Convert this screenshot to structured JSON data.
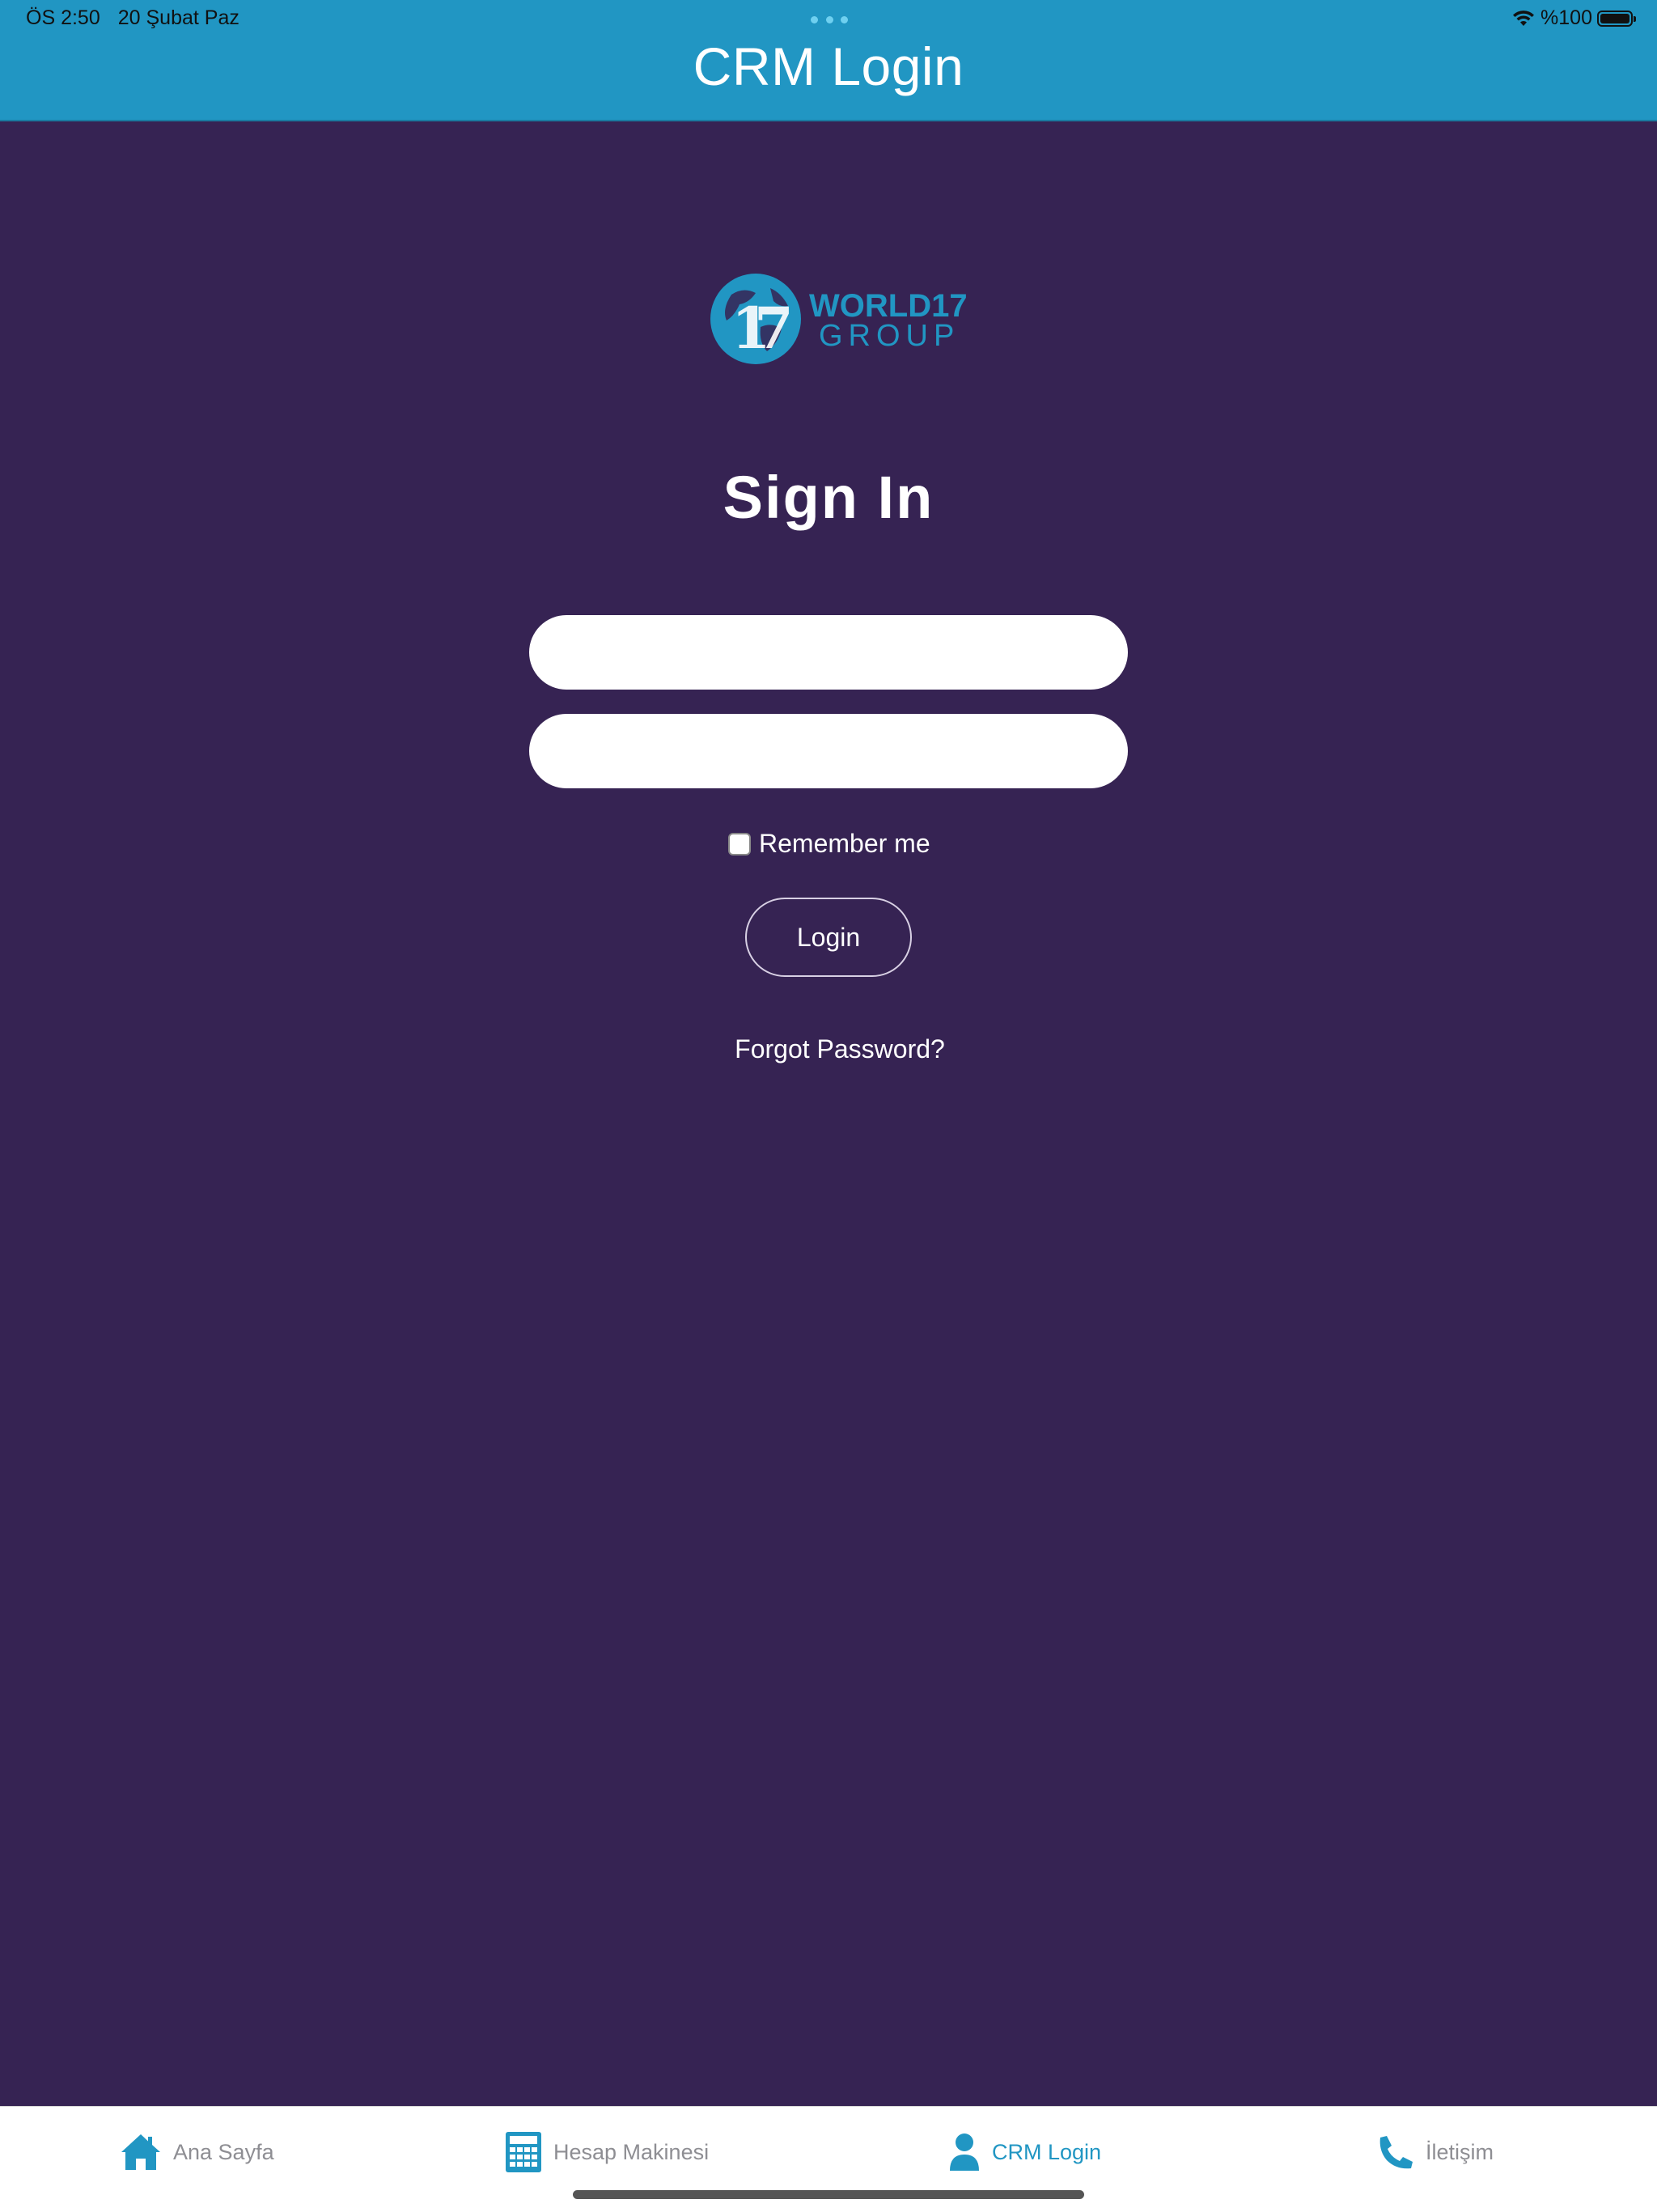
{
  "status_bar": {
    "time": "ÖS 2:50",
    "date": "20 Şubat Paz",
    "battery": "%100"
  },
  "header": {
    "title": "CRM Login"
  },
  "logo": {
    "line1": "WORLD17",
    "line2": "GROUP"
  },
  "form": {
    "title": "Sign In",
    "username_value": "",
    "password_value": "",
    "remember_label": "Remember me",
    "remember_checked": false,
    "login_label": "Login",
    "forgot_label": "Forgot Password?"
  },
  "tabbar": {
    "items": [
      {
        "label": "Ana Sayfa",
        "icon": "home-icon",
        "active": false
      },
      {
        "label": "Hesap Makinesi",
        "icon": "calculator-icon",
        "active": false
      },
      {
        "label": "CRM Login",
        "icon": "user-icon",
        "active": true
      },
      {
        "label": "İletişim",
        "icon": "phone-icon",
        "active": false
      }
    ]
  },
  "colors": {
    "header": "#2196c3",
    "background": "#362353",
    "accent": "#2196c3",
    "inactive_tab": "#8e8e93"
  }
}
